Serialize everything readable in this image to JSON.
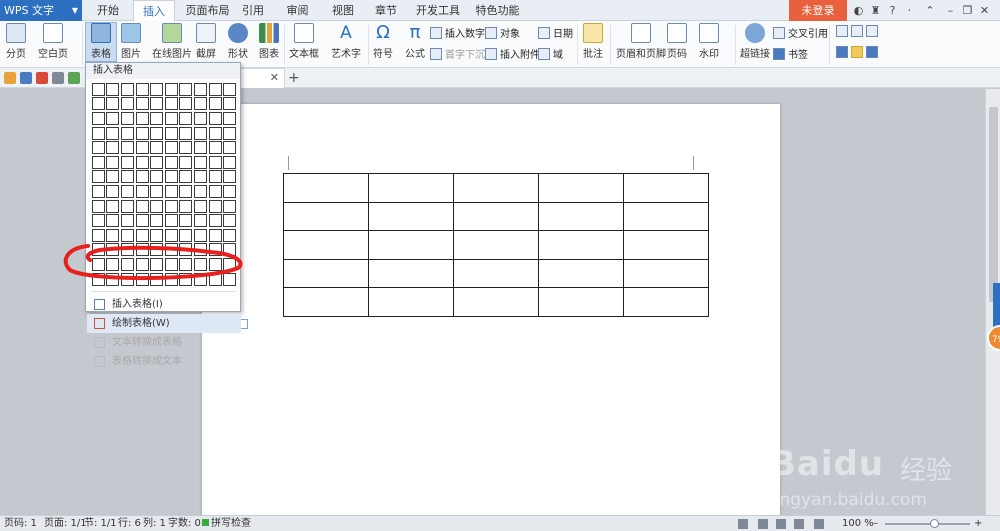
{
  "app": {
    "name": "WPS 文字"
  },
  "tabs": [
    "开始",
    "插入",
    "页面布局",
    "引用",
    "审阅",
    "视图",
    "章节",
    "开发工具",
    "特色功能"
  ],
  "active_tab": "插入",
  "login_label": "未登录",
  "ribbon": {
    "page_break": "分页",
    "blank_page": "空白页",
    "table": "表格",
    "picture": "图片",
    "online_picture": "在线图片",
    "screenshot": "截屏",
    "shapes": "形状",
    "chart": "图表",
    "textbox": "文本框",
    "wordart": "艺术字",
    "symbol": "符号",
    "formula": "公式",
    "insert_number": "插入数字",
    "object": "对象",
    "date": "日期",
    "dropcap": "首字下沉",
    "attachment": "插入附件",
    "field": "域",
    "comment": "批注",
    "header_footer": "页眉和页脚",
    "page_number": "页码",
    "watermark": "水印",
    "hyperlink": "超链接",
    "cross_ref": "交叉引用",
    "bookmark": "书签"
  },
  "dropdown": {
    "title": "插入表格",
    "items": [
      {
        "label": "插入表格(I)",
        "state": "normal"
      },
      {
        "label": "绘制表格(W)",
        "state": "highlighted"
      },
      {
        "label": "文本转换成表格",
        "state": "disabled"
      },
      {
        "label": "表格转换成文本",
        "state": "disabled"
      }
    ]
  },
  "status": {
    "page_num": "页码: 1",
    "pages": "页面: 1/1",
    "section": "节: 1/1",
    "row": "行: 6",
    "col": "列: 1",
    "words": "字数: 0",
    "spellcheck": "拼写检查",
    "zoom": "100 %"
  },
  "side_badge": "79",
  "watermark": {
    "brand": "Baidu",
    "cn": "经验",
    "url": "jingyan.baidu.com"
  },
  "colors": {
    "accent": "#2d6fc1",
    "login": "#e8603c",
    "annotation": "#e8201c"
  }
}
